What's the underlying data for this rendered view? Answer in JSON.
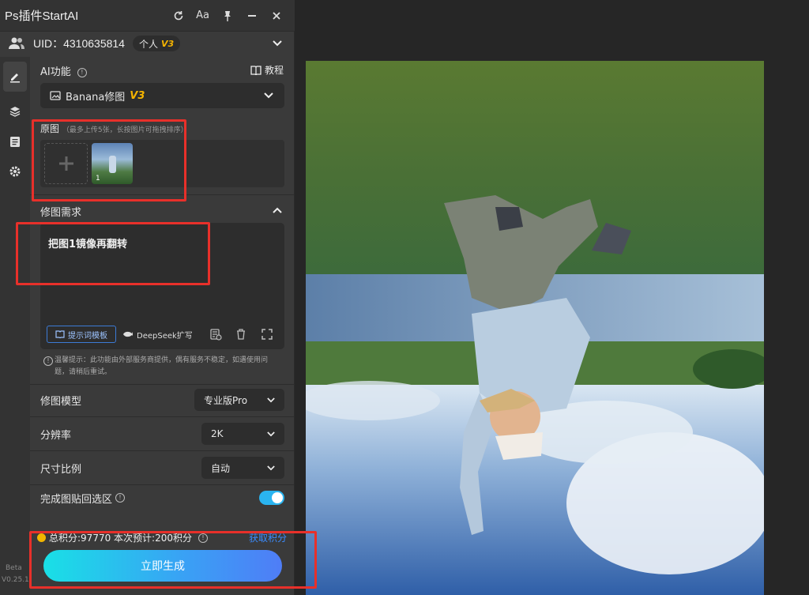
{
  "titlebar": {
    "title": "Ps插件StartAI",
    "icons": [
      "refresh-icon",
      "font-size-icon",
      "pin-icon",
      "minimize-icon",
      "close-icon"
    ],
    "font_label": "Aa"
  },
  "account": {
    "uid_label": "UID：4310635814",
    "tier": "个人",
    "tier_badge": "V3"
  },
  "sidebar": {
    "items": [
      "edit-icon",
      "layers-icon",
      "notes-icon",
      "settings-icon"
    ],
    "beta": "Beta",
    "version": "V0.25.1"
  },
  "ai_function": {
    "label": "AI功能",
    "tutorial": "教程",
    "selected": "Banana修图",
    "selected_badge": "V3"
  },
  "original": {
    "label": "原图",
    "hint": "（最多上传5张，长按图片可拖拽排序）",
    "thumb_index": "1"
  },
  "requirement": {
    "label": "修图需求",
    "text": "把图1镜像再翻转",
    "template_btn": "提示词模板",
    "deepseek_btn": "DeepSeek扩写"
  },
  "notice": "温馨提示：此功能由外部服务商提供，偶有服务不稳定，如遇使用问题，请稍后重试。",
  "settings": {
    "model_label": "修图模型",
    "model_value": "专业版Pro",
    "resolution_label": "分辨率",
    "resolution_value": "2K",
    "ratio_label": "尺寸比例",
    "ratio_value": "自动",
    "paste_back_label": "完成图贴回选区",
    "paste_back_on": true
  },
  "footer": {
    "points_text": "总积分:97770  本次预计:200积分",
    "get_points": "获取积分",
    "generate": "立即生成"
  },
  "colors": {
    "accent": "#2ab4f0",
    "badge": "#f5b400",
    "highlight_box": "#e8302a"
  }
}
